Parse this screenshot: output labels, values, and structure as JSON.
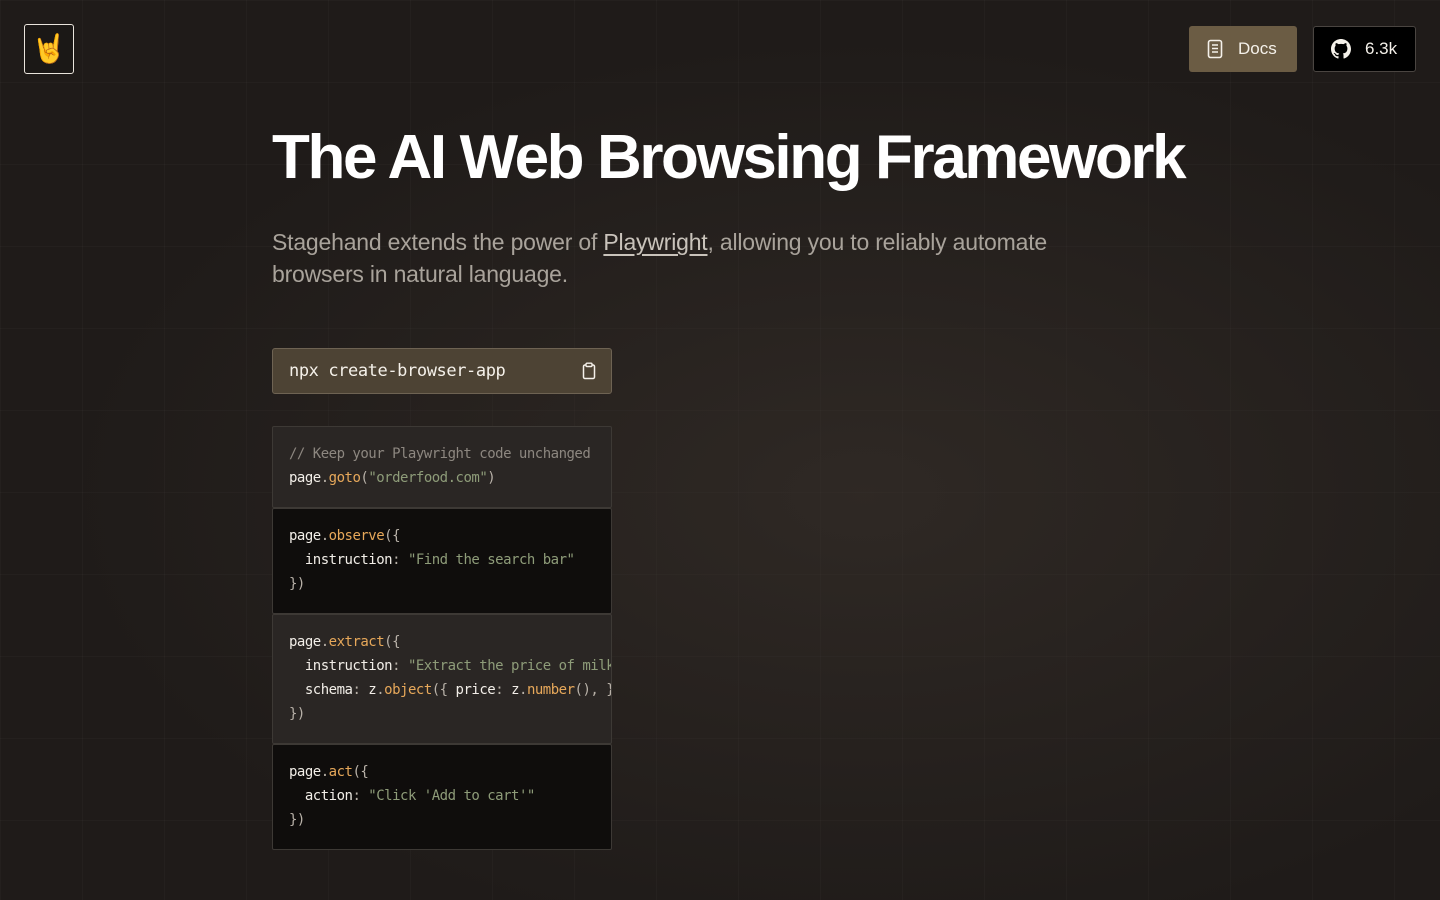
{
  "header": {
    "logo_emoji": "🤘",
    "logo_icon": "rock-hand-icon",
    "docs_label": "Docs",
    "docs_icon": "book-icon",
    "github_label": "6.3k",
    "github_icon": "github-icon"
  },
  "hero": {
    "title": "The AI Web Browsing Framework",
    "subtitle_before": "Stagehand extends the power of ",
    "subtitle_link": "Playwright",
    "subtitle_after": ", allowing you to reliably automate browsers in natural language."
  },
  "install": {
    "command": "npx create-browser-app",
    "copy_icon": "clipboard-icon"
  },
  "code_blocks": [
    {
      "theme": "light",
      "lines": [
        [
          {
            "t": "// Keep your Playwright code unchanged",
            "c": "comment"
          }
        ],
        [
          {
            "t": "page",
            "c": "id"
          },
          {
            "t": ".",
            "c": "punc"
          },
          {
            "t": "goto",
            "c": "fn"
          },
          {
            "t": "(",
            "c": "punc"
          },
          {
            "t": "\"orderfood.com\"",
            "c": "str"
          },
          {
            "t": ")",
            "c": "punc"
          }
        ]
      ]
    },
    {
      "theme": "dark",
      "lines": [
        [
          {
            "t": "page",
            "c": "id"
          },
          {
            "t": ".",
            "c": "punc"
          },
          {
            "t": "observe",
            "c": "fn"
          },
          {
            "t": "({",
            "c": "punc"
          }
        ],
        [
          {
            "t": "  instruction",
            "c": "id"
          },
          {
            "t": ": ",
            "c": "punc"
          },
          {
            "t": "\"Find the search bar\"",
            "c": "str"
          }
        ],
        [
          {
            "t": "})",
            "c": "punc"
          }
        ]
      ]
    },
    {
      "theme": "light",
      "lines": [
        [
          {
            "t": "page",
            "c": "id"
          },
          {
            "t": ".",
            "c": "punc"
          },
          {
            "t": "extract",
            "c": "fn"
          },
          {
            "t": "({",
            "c": "punc"
          }
        ],
        [
          {
            "t": "  instruction",
            "c": "id"
          },
          {
            "t": ": ",
            "c": "punc"
          },
          {
            "t": "\"Extract the price of milk\"",
            "c": "str"
          },
          {
            "t": ",",
            "c": "punc"
          }
        ],
        [
          {
            "t": "  schema",
            "c": "id"
          },
          {
            "t": ": ",
            "c": "punc"
          },
          {
            "t": "z",
            "c": "id"
          },
          {
            "t": ".",
            "c": "punc"
          },
          {
            "t": "object",
            "c": "fn"
          },
          {
            "t": "({ ",
            "c": "punc"
          },
          {
            "t": "price",
            "c": "id"
          },
          {
            "t": ": ",
            "c": "punc"
          },
          {
            "t": "z",
            "c": "id"
          },
          {
            "t": ".",
            "c": "punc"
          },
          {
            "t": "number",
            "c": "fn"
          },
          {
            "t": "(), }),",
            "c": "punc"
          }
        ],
        [
          {
            "t": "})",
            "c": "punc"
          }
        ]
      ]
    },
    {
      "theme": "dark",
      "lines": [
        [
          {
            "t": "page",
            "c": "id"
          },
          {
            "t": ".",
            "c": "punc"
          },
          {
            "t": "act",
            "c": "fn"
          },
          {
            "t": "({",
            "c": "punc"
          }
        ],
        [
          {
            "t": "  action",
            "c": "id"
          },
          {
            "t": ": ",
            "c": "punc"
          },
          {
            "t": "\"Click 'Add to cart'\"",
            "c": "str"
          }
        ],
        [
          {
            "t": "})",
            "c": "punc"
          }
        ]
      ]
    }
  ],
  "colors": {
    "background": "#1f1b19",
    "docs_button": "#6b5c44",
    "install_bg": "#4d4334",
    "code_fn": "#e7a85a",
    "code_str": "#8e9c79"
  }
}
